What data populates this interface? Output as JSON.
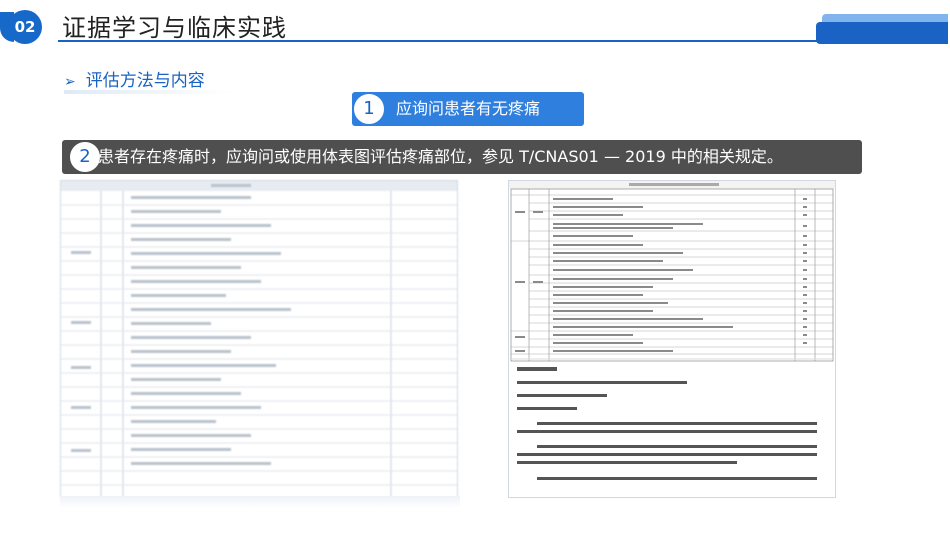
{
  "header": {
    "badge": "02",
    "title": "证据学习与临床实践"
  },
  "section": {
    "arrow": "➢",
    "label": "评估方法与内容"
  },
  "step1": {
    "num": "1",
    "text": "应询问患者有无疼痛"
  },
  "step2": {
    "num": "2",
    "text": "患者存在疼痛时，应询问或使用体表图评估疼痛部位，参见 T/CNAS01 — 2019 中的相关规定。"
  },
  "colors": {
    "primary": "#1a63c4",
    "pill1": "#2f7fde",
    "pill2": "#4f4f4f"
  }
}
